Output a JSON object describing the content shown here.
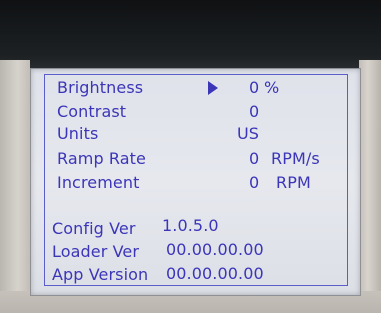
{
  "settings": [
    {
      "label": "Brightness",
      "value": "0",
      "unit": "%"
    },
    {
      "label": "Contrast",
      "value": "0",
      "unit": ""
    },
    {
      "label": "Units",
      "value": "US",
      "unit": ""
    },
    {
      "label": "Ramp Rate",
      "value": "0",
      "unit": "RPM/s"
    },
    {
      "label": "Increment",
      "value": "0",
      "unit": "RPM"
    }
  ],
  "info": [
    {
      "label": "Config Ver",
      "value": "1.0.5.0"
    },
    {
      "label": "Loader Ver",
      "value": "00.00.00.00"
    },
    {
      "label": "App Version",
      "value": "00.00.00.00"
    }
  ],
  "cursor_icon": "right-triangle-selection",
  "colors": {
    "text": "#3b35b8",
    "screen": "#e3e5ec"
  }
}
